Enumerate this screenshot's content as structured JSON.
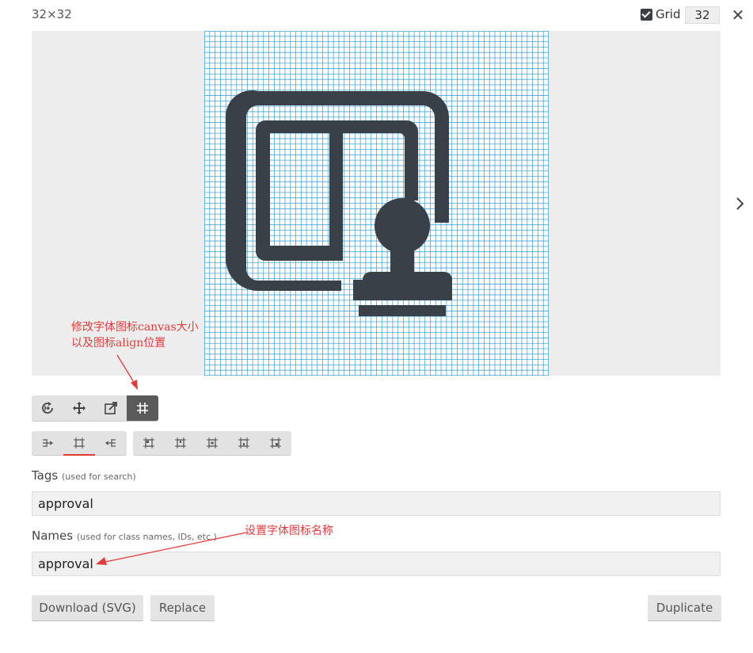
{
  "header": {
    "title": "32×32",
    "grid_label": "Grid",
    "grid_checked": true,
    "grid_size": "32"
  },
  "icon": {
    "name": "approval-icon",
    "grid_cells": 32,
    "color": "#3a4047"
  },
  "colors": {
    "accent": "#e23b3b",
    "grid_line": "#4aa3d8",
    "icon": "#3a4047"
  },
  "annotations": {
    "canvas_note_line1": "修改字体图标canvas大小",
    "canvas_note_line2": "以及图标align位置",
    "name_note": "设置字体图标名称"
  },
  "tools": [
    {
      "name": "reset-icon",
      "active": false
    },
    {
      "name": "move-icon",
      "active": false
    },
    {
      "name": "resize-icon",
      "active": false
    },
    {
      "name": "grid-align-icon",
      "active": true
    }
  ],
  "align_left": [
    {
      "name": "align-left-icon",
      "selected": false
    },
    {
      "name": "align-center-icon",
      "selected": true
    },
    {
      "name": "align-right-icon",
      "selected": false
    }
  ],
  "align_right": [
    {
      "name": "align-top-left-icon"
    },
    {
      "name": "align-top-icon"
    },
    {
      "name": "align-middle-icon"
    },
    {
      "name": "align-bottom-icon"
    },
    {
      "name": "align-bottom-right-icon"
    }
  ],
  "tags": {
    "label": "Tags",
    "hint": "(used for search)",
    "value": "approval"
  },
  "names": {
    "label": "Names",
    "hint": "(used for class names, IDs, etc.)",
    "value": "approval"
  },
  "buttons": {
    "download": "Download (SVG)",
    "replace": "Replace",
    "duplicate": "Duplicate"
  }
}
